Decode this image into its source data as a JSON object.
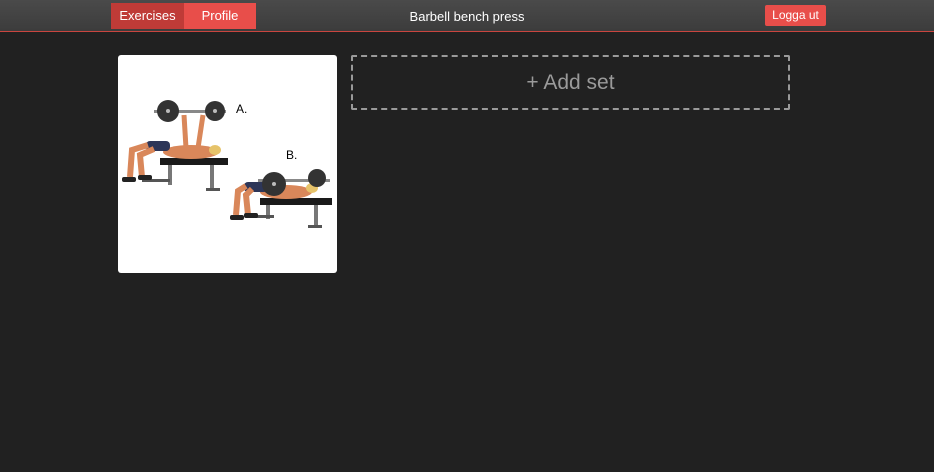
{
  "nav": {
    "exercises_label": "Exercises",
    "profile_label": "Profile"
  },
  "header": {
    "title": "Barbell bench press",
    "logout_label": "Logga ut"
  },
  "exercise_image": {
    "label_a": "A.",
    "label_b": "B."
  },
  "sets": {
    "add_label": "+ Add set"
  },
  "colors": {
    "background": "#212121",
    "topbar": "#444444",
    "accent": "#e84e4a",
    "accent_dark": "#bf3b37"
  }
}
